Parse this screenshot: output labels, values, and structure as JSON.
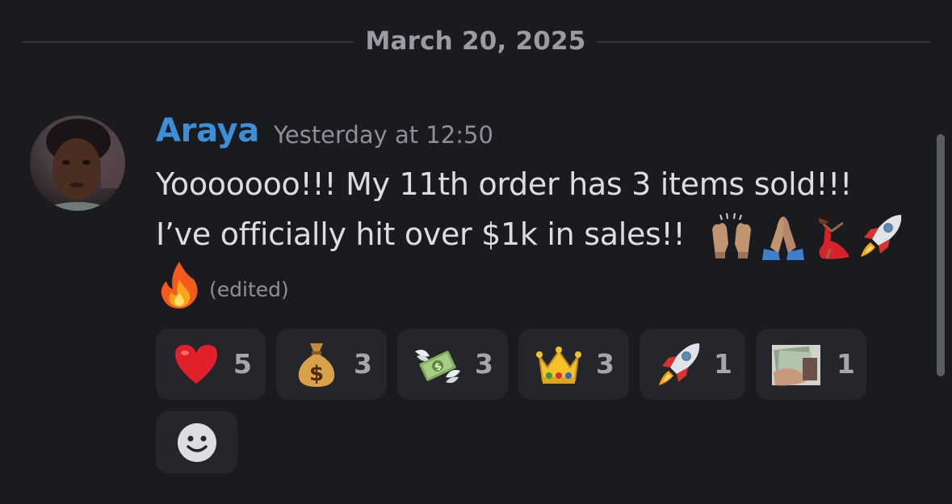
{
  "date_divider": {
    "text": "March 20, 2025"
  },
  "message": {
    "author": "Araya",
    "timestamp": "Yesterday at 12:50",
    "line1": "Yooooooo!!! My 11th order has 3 items sold!!!",
    "line2": "I’ve officially hit over $1k in sales!!",
    "inline_emojis": [
      "raising-hands-icon",
      "folded-hands-icon",
      "dancer-icon",
      "rocket-icon",
      "fire-icon"
    ],
    "edited_label": "(edited)",
    "author_color": "#3c8fd6"
  },
  "reactions": [
    {
      "emoji": "red-heart-icon",
      "count": "5"
    },
    {
      "emoji": "money-bag-icon",
      "count": "3"
    },
    {
      "emoji": "money-with-wings-icon",
      "count": "3"
    },
    {
      "emoji": "crown-icon",
      "count": "3"
    },
    {
      "emoji": "rocket-icon",
      "count": "1"
    },
    {
      "emoji": "cash-in-hand-icon",
      "count": "1"
    }
  ],
  "add_reaction": {
    "icon": "smile-face-icon"
  }
}
